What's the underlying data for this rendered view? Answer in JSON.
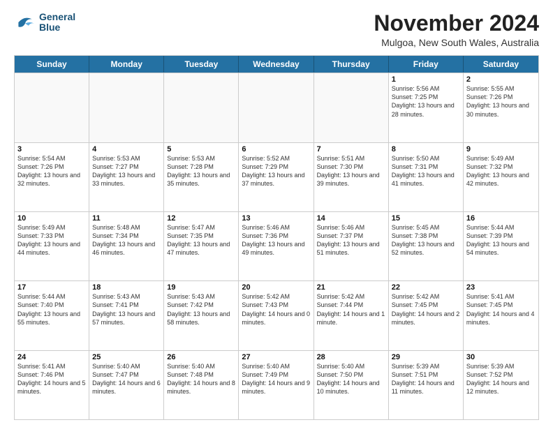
{
  "logo": {
    "line1": "General",
    "line2": "Blue"
  },
  "title": "November 2024",
  "subtitle": "Mulgoa, New South Wales, Australia",
  "dayHeaders": [
    "Sunday",
    "Monday",
    "Tuesday",
    "Wednesday",
    "Thursday",
    "Friday",
    "Saturday"
  ],
  "weeks": [
    [
      {
        "day": "",
        "info": ""
      },
      {
        "day": "",
        "info": ""
      },
      {
        "day": "",
        "info": ""
      },
      {
        "day": "",
        "info": ""
      },
      {
        "day": "",
        "info": ""
      },
      {
        "day": "1",
        "info": "Sunrise: 5:56 AM\nSunset: 7:25 PM\nDaylight: 13 hours\nand 28 minutes."
      },
      {
        "day": "2",
        "info": "Sunrise: 5:55 AM\nSunset: 7:26 PM\nDaylight: 13 hours\nand 30 minutes."
      }
    ],
    [
      {
        "day": "3",
        "info": "Sunrise: 5:54 AM\nSunset: 7:26 PM\nDaylight: 13 hours\nand 32 minutes."
      },
      {
        "day": "4",
        "info": "Sunrise: 5:53 AM\nSunset: 7:27 PM\nDaylight: 13 hours\nand 33 minutes."
      },
      {
        "day": "5",
        "info": "Sunrise: 5:53 AM\nSunset: 7:28 PM\nDaylight: 13 hours\nand 35 minutes."
      },
      {
        "day": "6",
        "info": "Sunrise: 5:52 AM\nSunset: 7:29 PM\nDaylight: 13 hours\nand 37 minutes."
      },
      {
        "day": "7",
        "info": "Sunrise: 5:51 AM\nSunset: 7:30 PM\nDaylight: 13 hours\nand 39 minutes."
      },
      {
        "day": "8",
        "info": "Sunrise: 5:50 AM\nSunset: 7:31 PM\nDaylight: 13 hours\nand 41 minutes."
      },
      {
        "day": "9",
        "info": "Sunrise: 5:49 AM\nSunset: 7:32 PM\nDaylight: 13 hours\nand 42 minutes."
      }
    ],
    [
      {
        "day": "10",
        "info": "Sunrise: 5:49 AM\nSunset: 7:33 PM\nDaylight: 13 hours\nand 44 minutes."
      },
      {
        "day": "11",
        "info": "Sunrise: 5:48 AM\nSunset: 7:34 PM\nDaylight: 13 hours\nand 46 minutes."
      },
      {
        "day": "12",
        "info": "Sunrise: 5:47 AM\nSunset: 7:35 PM\nDaylight: 13 hours\nand 47 minutes."
      },
      {
        "day": "13",
        "info": "Sunrise: 5:46 AM\nSunset: 7:36 PM\nDaylight: 13 hours\nand 49 minutes."
      },
      {
        "day": "14",
        "info": "Sunrise: 5:46 AM\nSunset: 7:37 PM\nDaylight: 13 hours\nand 51 minutes."
      },
      {
        "day": "15",
        "info": "Sunrise: 5:45 AM\nSunset: 7:38 PM\nDaylight: 13 hours\nand 52 minutes."
      },
      {
        "day": "16",
        "info": "Sunrise: 5:44 AM\nSunset: 7:39 PM\nDaylight: 13 hours\nand 54 minutes."
      }
    ],
    [
      {
        "day": "17",
        "info": "Sunrise: 5:44 AM\nSunset: 7:40 PM\nDaylight: 13 hours\nand 55 minutes."
      },
      {
        "day": "18",
        "info": "Sunrise: 5:43 AM\nSunset: 7:41 PM\nDaylight: 13 hours\nand 57 minutes."
      },
      {
        "day": "19",
        "info": "Sunrise: 5:43 AM\nSunset: 7:42 PM\nDaylight: 13 hours\nand 58 minutes."
      },
      {
        "day": "20",
        "info": "Sunrise: 5:42 AM\nSunset: 7:43 PM\nDaylight: 14 hours\nand 0 minutes."
      },
      {
        "day": "21",
        "info": "Sunrise: 5:42 AM\nSunset: 7:44 PM\nDaylight: 14 hours\nand 1 minute."
      },
      {
        "day": "22",
        "info": "Sunrise: 5:42 AM\nSunset: 7:45 PM\nDaylight: 14 hours\nand 2 minutes."
      },
      {
        "day": "23",
        "info": "Sunrise: 5:41 AM\nSunset: 7:45 PM\nDaylight: 14 hours\nand 4 minutes."
      }
    ],
    [
      {
        "day": "24",
        "info": "Sunrise: 5:41 AM\nSunset: 7:46 PM\nDaylight: 14 hours\nand 5 minutes."
      },
      {
        "day": "25",
        "info": "Sunrise: 5:40 AM\nSunset: 7:47 PM\nDaylight: 14 hours\nand 6 minutes."
      },
      {
        "day": "26",
        "info": "Sunrise: 5:40 AM\nSunset: 7:48 PM\nDaylight: 14 hours\nand 8 minutes."
      },
      {
        "day": "27",
        "info": "Sunrise: 5:40 AM\nSunset: 7:49 PM\nDaylight: 14 hours\nand 9 minutes."
      },
      {
        "day": "28",
        "info": "Sunrise: 5:40 AM\nSunset: 7:50 PM\nDaylight: 14 hours\nand 10 minutes."
      },
      {
        "day": "29",
        "info": "Sunrise: 5:39 AM\nSunset: 7:51 PM\nDaylight: 14 hours\nand 11 minutes."
      },
      {
        "day": "30",
        "info": "Sunrise: 5:39 AM\nSunset: 7:52 PM\nDaylight: 14 hours\nand 12 minutes."
      }
    ]
  ]
}
